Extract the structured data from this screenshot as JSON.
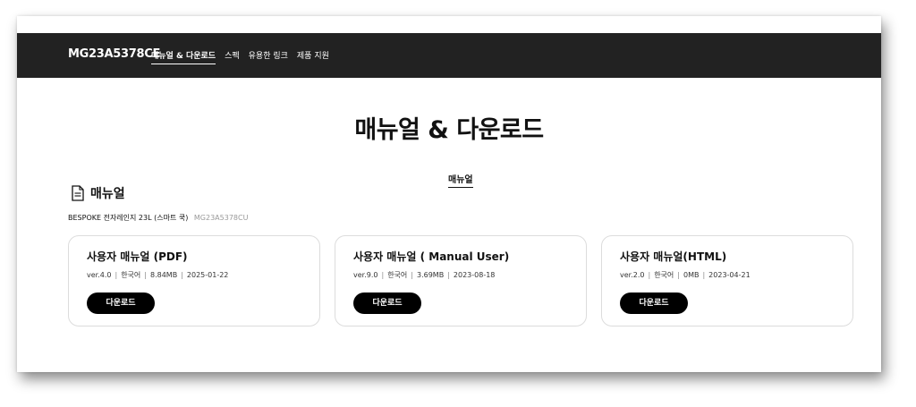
{
  "header": {
    "model": "MG23A5378CE",
    "nav": [
      {
        "label": "매뉴얼 & 다운로드",
        "active": true
      },
      {
        "label": "스펙",
        "active": false
      },
      {
        "label": "유용한 링크",
        "active": false
      },
      {
        "label": "제품 지원",
        "active": false
      }
    ]
  },
  "main": {
    "title": "매뉴얼 & 다운로드",
    "tab": "매뉴얼",
    "section_title": "매뉴얼",
    "section_icon": "document-icon",
    "product_name": "BESPOKE 전자레인지 23L (스마트 쿡)",
    "product_code": "MG23A5378CU",
    "cards": [
      {
        "title": "사용자 매뉴얼 (PDF)",
        "version": "ver.4.0",
        "language": "한국어",
        "size": "8.84MB",
        "date": "2025-01-22",
        "button": "다운로드"
      },
      {
        "title": "사용자 매뉴얼 ( Manual User)",
        "version": "ver.9.0",
        "language": "한국어",
        "size": "3.69MB",
        "date": "2023-08-18",
        "button": "다운로드"
      },
      {
        "title": "사용자 매뉴얼(HTML)",
        "version": "ver.2.0",
        "language": "한국어",
        "size": "0MB",
        "date": "2023-04-21",
        "button": "다운로드"
      }
    ]
  },
  "colors": {
    "header_bg": "#222222",
    "button_bg": "#000000",
    "card_border": "#dcdcdc"
  }
}
